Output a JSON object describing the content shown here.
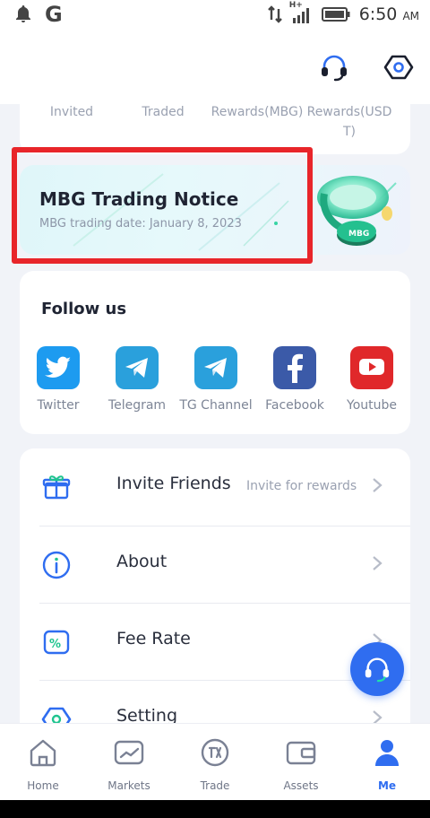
{
  "status_bar": {
    "carrier_letter": "G",
    "network": "H+",
    "time": "6:50",
    "ampm": "AM"
  },
  "header": {
    "icons": [
      "headset-icon",
      "settings-hexagon-icon"
    ]
  },
  "stats": {
    "labels": [
      "Invited",
      "Traded",
      "Rewards(MBG)",
      "Rewards(USD",
      "T)"
    ]
  },
  "banner": {
    "title": "MBG Trading Notice",
    "subtitle": "MBG trading date: January 8, 2023",
    "coin_label": "MBG"
  },
  "follow": {
    "title": "Follow us",
    "items": [
      {
        "label": "Twitter",
        "icon": "twitter-icon",
        "color": "#1d9bf0"
      },
      {
        "label": "Telegram",
        "icon": "telegram-icon",
        "color": "#2aa0dc"
      },
      {
        "label": "TG Channel",
        "icon": "telegram-icon",
        "color": "#2aa0dc"
      },
      {
        "label": "Facebook",
        "icon": "facebook-icon",
        "color": "#3b5aa8"
      },
      {
        "label": "Youtube",
        "icon": "youtube-icon",
        "color": "#e0282a"
      }
    ]
  },
  "menu": {
    "items": [
      {
        "label": "Invite Friends",
        "hint": "Invite for rewards",
        "icon": "gift-icon"
      },
      {
        "label": "About",
        "hint": "",
        "icon": "info-icon"
      },
      {
        "label": "Fee Rate",
        "hint": "",
        "icon": "percent-icon"
      },
      {
        "label": "Setting",
        "hint": "",
        "icon": "setting-hexagon-icon"
      }
    ]
  },
  "bottom_nav": {
    "items": [
      {
        "label": "Home",
        "icon": "home-icon"
      },
      {
        "label": "Markets",
        "icon": "markets-icon"
      },
      {
        "label": "Trade",
        "icon": "trade-icon"
      },
      {
        "label": "Assets",
        "icon": "wallet-icon"
      },
      {
        "label": "Me",
        "icon": "person-icon",
        "active": true
      }
    ]
  },
  "colors": {
    "accent": "#2f6df0",
    "highlight_box": "#e8252a",
    "background": "#f1f3f8"
  }
}
